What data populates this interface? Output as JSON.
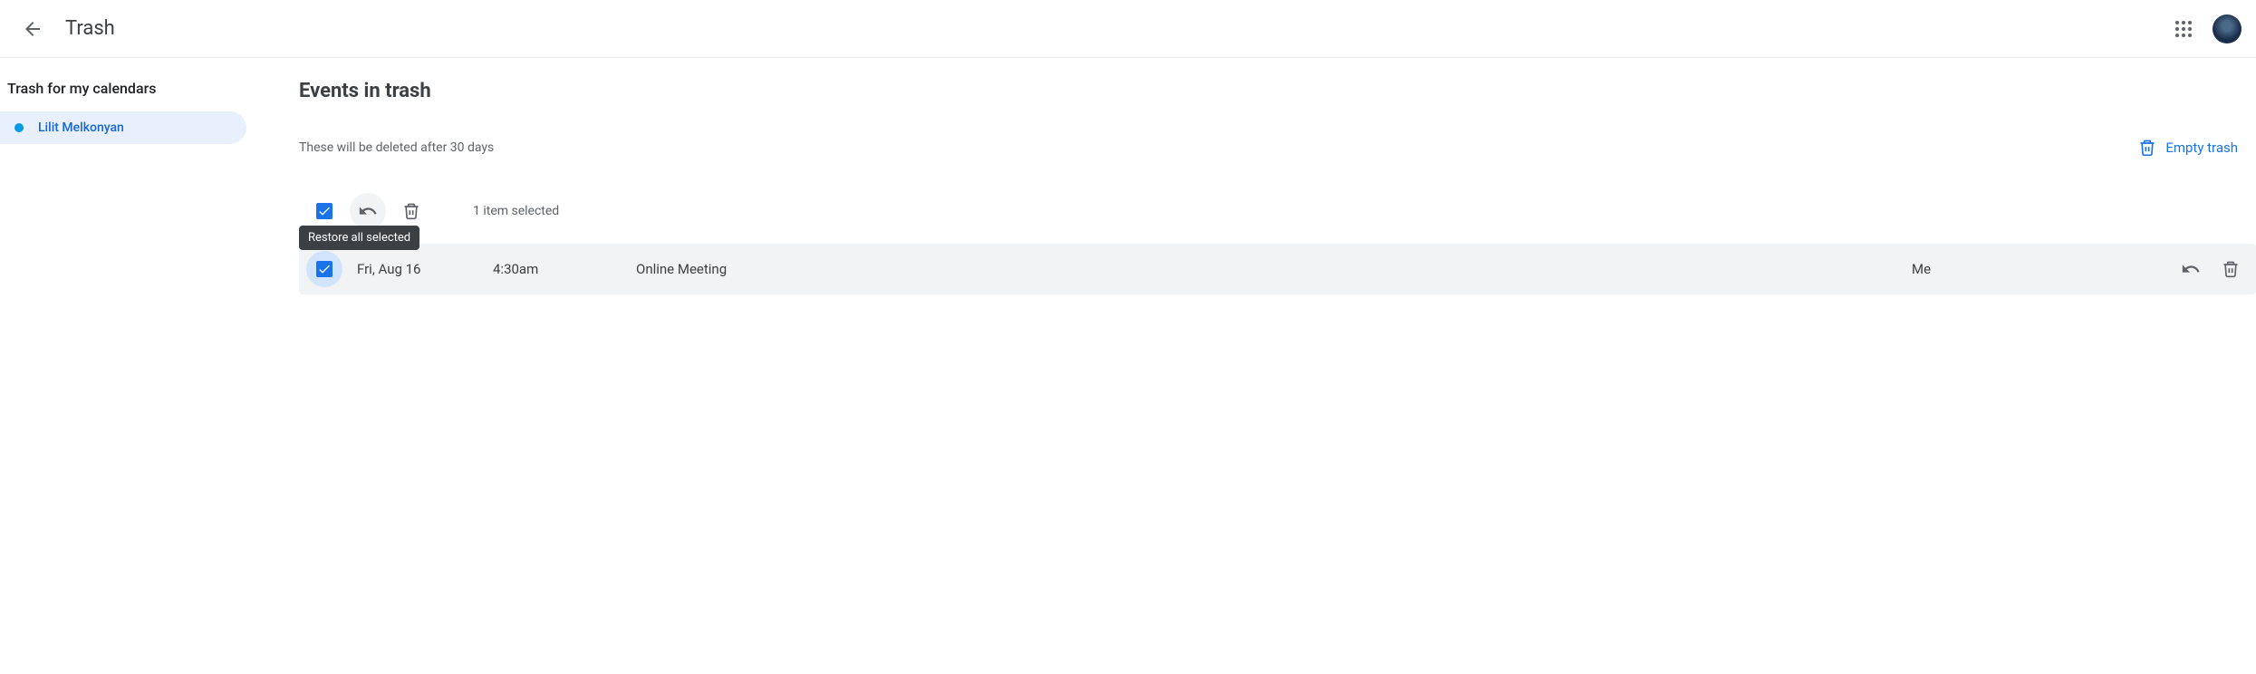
{
  "header": {
    "title": "Trash"
  },
  "sidebar": {
    "title": "Trash for my calendars",
    "items": [
      {
        "label": "Lilit Melkonyan",
        "color": "#039be5"
      }
    ]
  },
  "content": {
    "title": "Events in trash",
    "retention_text": "These will be deleted after 30 days",
    "empty_trash_label": "Empty trash",
    "selection_text": "1 item selected",
    "tooltip_text": "Restore all selected",
    "events": [
      {
        "date": "Fri, Aug 16",
        "time": "4:30am",
        "title": "Online Meeting",
        "owner": "Me"
      }
    ]
  }
}
